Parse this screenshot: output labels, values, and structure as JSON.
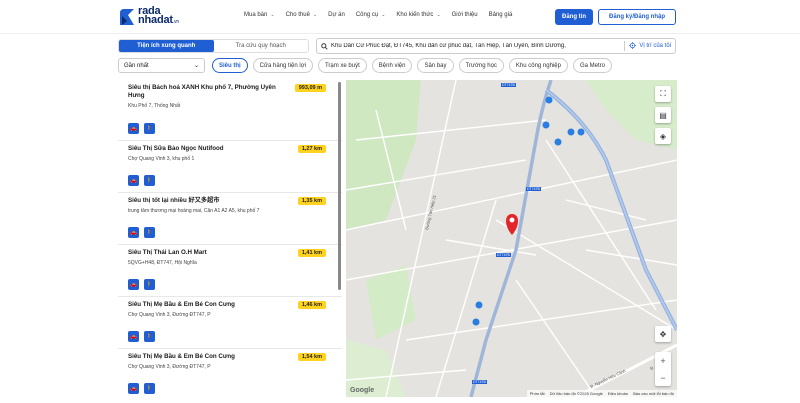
{
  "header": {
    "logo_top": "rada",
    "logo_bottom": "nhadat",
    "logo_suffix": ".vn",
    "nav": [
      {
        "label": "Mua bán",
        "dropdown": true
      },
      {
        "label": "Cho thuê",
        "dropdown": true
      },
      {
        "label": "Dự án",
        "dropdown": false
      },
      {
        "label": "Công cụ",
        "dropdown": true
      },
      {
        "label": "Kho kiến thức",
        "dropdown": true
      },
      {
        "label": "Giới thiệu",
        "dropdown": false
      },
      {
        "label": "Bảng giá",
        "dropdown": false
      }
    ],
    "login": "Đăng tin",
    "register": "Đăng ký/Đăng nhập",
    "accent": "#1f5fd3"
  },
  "tabs": {
    "active": "Tiện ích xung quanh",
    "inactive": "Tra cứu quy hoạch"
  },
  "search": {
    "value": "Khu Dân Cư Phúc Đạt, ĐT745, Khu dân cư phúc đạt, Tân Hiệp, Tân Uyên, Bình Dương,",
    "locate": "Vị trí của tôi"
  },
  "sort": {
    "value": "Gần nhất"
  },
  "chips": [
    {
      "label": "Siêu thị",
      "active": true
    },
    {
      "label": "Cửa hàng tiện lợi",
      "active": false
    },
    {
      "label": "Trạm xe buýt",
      "active": false
    },
    {
      "label": "Bệnh viện",
      "active": false
    },
    {
      "label": "Sân bay",
      "active": false
    },
    {
      "label": "Trường học",
      "active": false
    },
    {
      "label": "Khu công nghiệp",
      "active": false
    },
    {
      "label": "Ga Metro",
      "active": false
    }
  ],
  "places": [
    {
      "name": "Siêu thị Bách hoá XANH Khu phố 7, Phường Uyên Hưng",
      "address": "Khu Phố 7, Thống Nhất",
      "distance": "993,09 m"
    },
    {
      "name": "Siêu Thị Sữa Bảo Ngọc Nutifood",
      "address": "Chợ Quang Vinh 3, khu phố 1",
      "distance": "1,27 km"
    },
    {
      "name": "Siêu thị tốt lại nhiều 好又多超市",
      "address": "trung tâm thương mại hoàng mai, Căn A1 A2 A5, khu phố 7",
      "distance": "1,35 km"
    },
    {
      "name": "Siêu Thị Thái Lan O.H Mart",
      "address": "5QVG+H48, ĐT747, Hội Nghĩa",
      "distance": "1,41 km"
    },
    {
      "name": "Siêu Thị Mẹ Bầu & Em Bé Con Cưng",
      "address": "Chợ Quang Vinh 3, Đường ĐT747, P",
      "distance": "1,46 km"
    },
    {
      "name": "Siêu Thị Mẹ Bầu & Em Bé Con Cưng",
      "address": "Chợ Quang Vinh 3, Đường ĐT747, P",
      "distance": "1,54 km"
    }
  ],
  "map": {
    "brand": "Google",
    "attribution": [
      "Phím tắt",
      "Dữ liệu bản đồ ©2025 Google",
      "Điều khoản",
      "Báo cáo một lỗi bản đồ"
    ],
    "road_labels": [
      "DT747B",
      "DT747B",
      "DT747B",
      "DT747B"
    ],
    "street_label": "Đường Tân Hiệp 21",
    "street_label_2": "Đ. Nguyễn Hữu Cảnh",
    "street_label_3": "Đ. Ngọc"
  }
}
